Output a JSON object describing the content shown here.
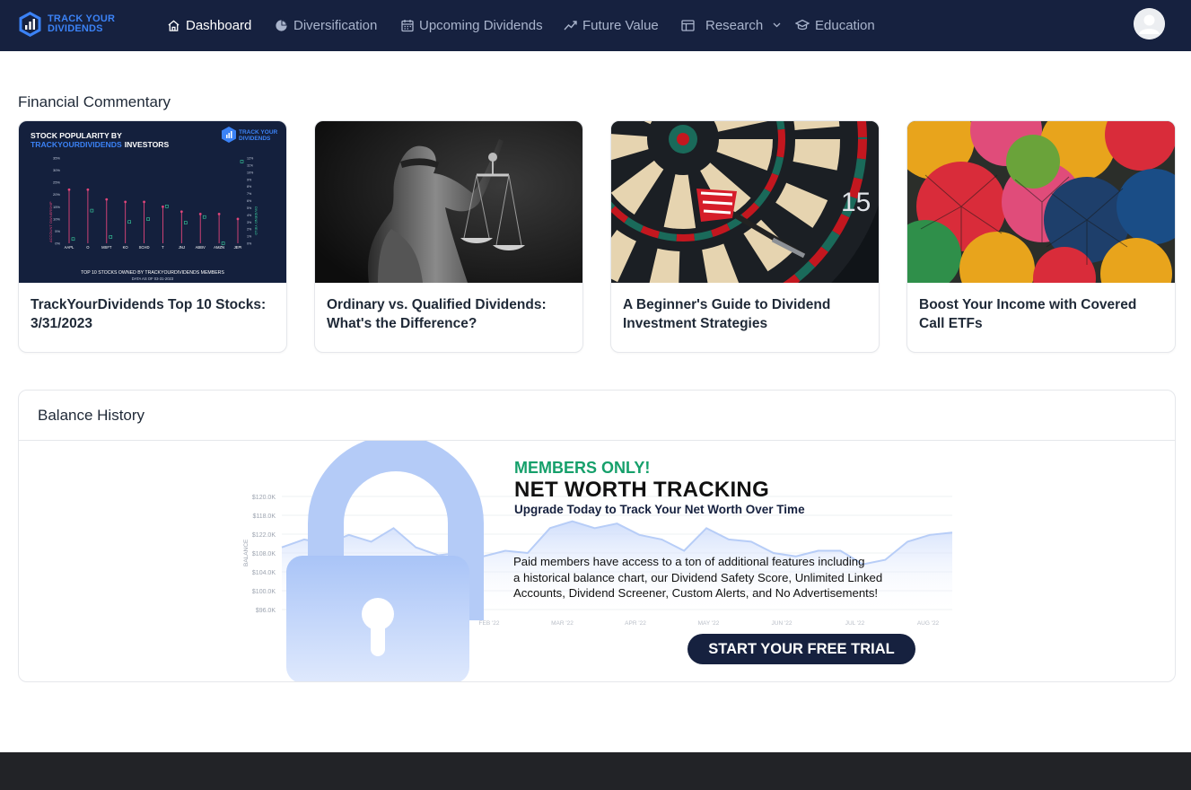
{
  "brand": {
    "line1": "TRACK YOUR",
    "line2": "DIVIDENDS",
    "logo_icon": "bar-chart-shield-icon",
    "accent": "#3b82f6"
  },
  "nav": {
    "items": [
      {
        "label": "Dashboard",
        "icon": "home-icon",
        "active": true
      },
      {
        "label": "Diversification",
        "icon": "pie-chart-icon"
      },
      {
        "label": "Upcoming Dividends",
        "icon": "calendar-icon"
      },
      {
        "label": "Future Value",
        "icon": "trend-line-icon"
      },
      {
        "label": "Research",
        "icon": "table-icon",
        "dropdown": true
      },
      {
        "label": "Education",
        "icon": "graduation-cap-icon"
      }
    ],
    "avatar_icon": "user-avatar-icon",
    "colors": {
      "background": "#16213f",
      "inactive": "#a9b4cc",
      "active": "#ffffff"
    }
  },
  "commentary": {
    "title": "Financial Commentary",
    "cards": [
      {
        "title": "TrackYourDividends Top 10 Stocks: 3/31/2023",
        "image": {
          "heading_line1": "STOCK POPULARITY BY",
          "heading_brand": "TRACKYOURDIVIDENDS",
          "heading_tail": "INVESTORS",
          "logo_line1": "TRACK YOUR",
          "logo_line2": "DIVIDENDS",
          "left_axis": "ACCOUNT OWNERSHIP",
          "right_axis": "DIVIDEND YIELD",
          "left_ticks": [
            "35%",
            "30%",
            "25%",
            "20%",
            "15%",
            "10%",
            "5%",
            "0%"
          ],
          "right_ticks": [
            "12%",
            "11%",
            "10%",
            "9%",
            "8%",
            "7%",
            "6%",
            "5%",
            "4%",
            "3%",
            "2%",
            "1%",
            "0%"
          ],
          "tickers": [
            "AAPL",
            "O",
            "MSFT",
            "KO",
            "SCHD",
            "T",
            "JNJ",
            "ABBV",
            "AMZN",
            "JEPI"
          ],
          "footer": "TOP 10 STOCKS OWNED BY TRACKYOURDIVIDENDS MEMBERS",
          "date": "DATA AS OF 03-31-2023"
        }
      },
      {
        "title": "Ordinary vs. Qualified Dividends: What's the Difference?",
        "image_icon": "scales-of-justice-statue-icon"
      },
      {
        "title": "A Beginner's Guide to Dividend Investment Strategies",
        "image_icon": "dartboard-icon",
        "image_number": "15"
      },
      {
        "title": "Boost Your Income with Covered Call ETFs",
        "image_icon": "umbrellas-icon"
      }
    ]
  },
  "balance": {
    "title": "Balance History",
    "upsell": {
      "eyebrow": "MEMBERS ONLY!",
      "headline": "NET WORTH TRACKING",
      "subhead": "Upgrade Today to Track Your Net Worth Over Time",
      "body_line1": "Paid members have access to a ton of additional features including",
      "body_line2": "a historical balance chart, our Dividend Safety Score, Unlimited Linked",
      "body_line3": "Accounts, Dividend Screener, Custom Alerts, and No Advertisements!",
      "cta": "START YOUR FREE TRIAL",
      "lock_icon": "padlock-icon",
      "eyebrow_color": "#16a06b"
    },
    "chart_data": {
      "type": "area",
      "ylabel": "BALANCE",
      "y_ticks": [
        "$120.0K",
        "$118.0K",
        "$122.0K",
        "$108.0K",
        "$104.0K",
        "$100.0K",
        "$96.0K"
      ],
      "x_ticks": [
        "FEB '22",
        "MAR '22",
        "APR '22",
        "MAY '22",
        "JUN '22",
        "JUL '22",
        "AUG '22"
      ],
      "series_relative": [
        0.55,
        0.62,
        0.58,
        0.66,
        0.6,
        0.72,
        0.55,
        0.48,
        0.5,
        0.47,
        0.52,
        0.5,
        0.72,
        0.78,
        0.72,
        0.76,
        0.66,
        0.62,
        0.52,
        0.72,
        0.62,
        0.6,
        0.5,
        0.47,
        0.52,
        0.52,
        0.4,
        0.44,
        0.6,
        0.66,
        0.68
      ]
    }
  }
}
